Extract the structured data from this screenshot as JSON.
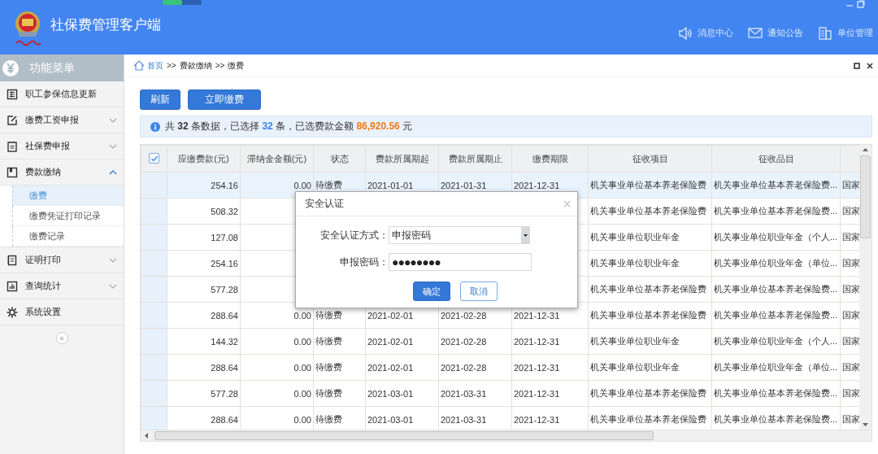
{
  "header": {
    "title": "社保费管理客户端",
    "nav": [
      {
        "label": "消息中心"
      },
      {
        "label": "通知公告"
      },
      {
        "label": "单位管理"
      }
    ]
  },
  "sidebar": {
    "title": "功能菜单",
    "items": [
      {
        "label": "职工参保信息更新",
        "kind": "link",
        "selected": false
      },
      {
        "label": "缴费工资申报",
        "kind": "group",
        "expanded": false,
        "selected": false
      },
      {
        "label": "社保费申报",
        "kind": "group",
        "expanded": false,
        "selected": false
      },
      {
        "label": "费款缴纳",
        "kind": "group",
        "expanded": true,
        "selected": false,
        "children": [
          {
            "label": "缴费",
            "selected": true
          },
          {
            "label": "缴费凭证打印记录",
            "selected": false
          },
          {
            "label": "缴费记录",
            "selected": false
          }
        ]
      },
      {
        "label": "证明打印",
        "kind": "group",
        "expanded": false,
        "selected": false
      },
      {
        "label": "查询统计",
        "kind": "group",
        "expanded": false,
        "selected": false
      },
      {
        "label": "系统设置",
        "kind": "link",
        "selected": false
      }
    ],
    "collapse": "«"
  },
  "breadcrumb": [
    {
      "label": "首页",
      "kind": "home"
    },
    {
      "label": ">>",
      "kind": "sep"
    },
    {
      "label": "费款缴纳",
      "kind": "page"
    },
    {
      "label": ">>",
      "kind": "sep"
    },
    {
      "label": "缴费",
      "kind": "page"
    }
  ],
  "toolbar": {
    "buttons": [
      "刷新",
      "立即缴费"
    ]
  },
  "summary": [
    {
      "text": "共 ",
      "kind": "plain"
    },
    {
      "text": "32",
      "kind": "bold"
    },
    {
      "text": " 条数据，已选择 ",
      "kind": "plain"
    },
    {
      "text": "32",
      "kind": "count"
    },
    {
      "text": " 条，已选费款金额 ",
      "kind": "plain"
    },
    {
      "text": "86,920.56",
      "kind": "amount"
    },
    {
      "text": " 元",
      "kind": "plain"
    }
  ],
  "table": {
    "all_checked": true,
    "columns": [
      "应缴费款(元)",
      "滞纳金金额(元)",
      "状态",
      "费款所属期起",
      "费款所属期止",
      "缴费期限",
      "征收项目",
      "征收品目"
    ],
    "rows": [
      {
        "selected": true,
        "cells": [
          "254.16",
          "0.00",
          "待缴费",
          "2021-01-01",
          "2021-01-31",
          "2021-12-31",
          "机关事业单位基本养老保险费",
          "机关事业单位基本养老保险费...",
          "国家"
        ]
      },
      {
        "selected": false,
        "cells": [
          "508.32",
          null,
          null,
          null,
          null,
          null,
          "机关事业单位基本养老保险费",
          "机关事业单位基本养老保险费...",
          "国家"
        ]
      },
      {
        "selected": false,
        "cells": [
          "127.08",
          null,
          null,
          null,
          null,
          null,
          "机关事业单位职业年金",
          "机关事业单位职业年金（个人...",
          "国家"
        ]
      },
      {
        "selected": false,
        "cells": [
          "254.16",
          null,
          null,
          null,
          null,
          null,
          "机关事业单位职业年金",
          "机关事业单位职业年金（单位...",
          "国家"
        ]
      },
      {
        "selected": false,
        "cells": [
          "577.28",
          null,
          null,
          null,
          null,
          null,
          "机关事业单位基本养老保险费",
          "机关事业单位基本养老保险费...",
          "国家"
        ]
      },
      {
        "selected": false,
        "cells": [
          "288.64",
          "0.00",
          "待缴费",
          "2021-02-01",
          "2021-02-28",
          "2021-12-31",
          "机关事业单位基本养老保险费",
          "机关事业单位基本养老保险费...",
          "国家"
        ]
      },
      {
        "selected": false,
        "cells": [
          "144.32",
          "0.00",
          "待缴费",
          "2021-02-01",
          "2021-02-28",
          "2021-12-31",
          "机关事业单位职业年金",
          "机关事业单位职业年金（个人...",
          "国家"
        ]
      },
      {
        "selected": false,
        "cells": [
          "288.64",
          "0.00",
          "待缴费",
          "2021-02-01",
          "2021-02-28",
          "2021-12-31",
          "机关事业单位职业年金",
          "机关事业单位职业年金（单位...",
          "国家"
        ]
      },
      {
        "selected": false,
        "cells": [
          "577.28",
          "0.00",
          "待缴费",
          "2021-03-01",
          "2021-03-31",
          "2021-12-31",
          "机关事业单位基本养老保险费",
          "机关事业单位基本养老保险费...",
          "国家"
        ]
      },
      {
        "selected": false,
        "cells": [
          "288.64",
          "0.00",
          "待缴费",
          "2021-03-01",
          "2021-03-31",
          "2021-12-31",
          "机关事业单位基本养老保险费",
          "机关事业单位基本养老保险费...",
          "国家"
        ]
      }
    ]
  },
  "dialog": {
    "title": "安全认证",
    "fields": [
      {
        "label": "安全认证方式：",
        "kind": "select",
        "value": "申报密码"
      },
      {
        "label": "申报密码：",
        "kind": "password",
        "value": "●●●●●●●●"
      }
    ],
    "buttons": [
      {
        "label": "确定",
        "kind": "primary"
      },
      {
        "label": "取消",
        "kind": "secondary"
      }
    ]
  }
}
